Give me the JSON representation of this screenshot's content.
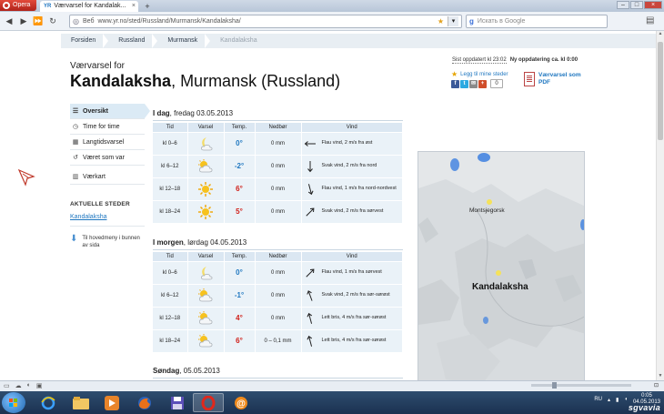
{
  "browser": {
    "opera_label": "Opera",
    "tab_icon": "YR",
    "tab_title": "Værvarsel for Kandalak...",
    "tab_close": "×",
    "new_tab": "+",
    "address_label": "Веб",
    "url": "www.yr.no/sted/Russland/Murmansk/Kandalaksha/",
    "search_placeholder": "Искать в Google"
  },
  "breadcrumbs": [
    "Forsiden",
    "Russland",
    "Murmansk",
    "Kandalaksha"
  ],
  "header": {
    "sub": "Værvarsel for",
    "place": "Kandalaksha",
    "region": ", Murmansk (Russland)",
    "updated_label": "Sist oppdatert kl 23:02",
    "next_update": "Ny oppdatering ca. kl 0:00",
    "add_favorite": "Legg til mine steder",
    "social_count": "0",
    "pdf_label": "Værvarsel som PDF"
  },
  "sidebar": {
    "items": [
      {
        "label": "Oversikt",
        "icon": "list-icon"
      },
      {
        "label": "Time for time",
        "icon": "clock-icon"
      },
      {
        "label": "Langtidsvarsel",
        "icon": "calendar-icon"
      },
      {
        "label": "Været som var",
        "icon": "history-icon"
      },
      {
        "label": "Værkart",
        "icon": "map-icon"
      }
    ],
    "current_heading": "AKTUELLE STEDER",
    "current_place": "Kandalaksha",
    "to_top": "Til hovedmeny i bunnen av sida"
  },
  "columns": [
    "Tid",
    "Varsel",
    "Temp.",
    "Nedbør",
    "Vind"
  ],
  "days": [
    {
      "prefix": "I dag",
      "date": ", fredag 03.05.2013",
      "rows": [
        {
          "time": "kl 0–6",
          "symbol": "moon-partly",
          "temp": "0°",
          "temp_color": "#1f77c0",
          "precip": "0 mm",
          "wind": "Flau vind, 2 m/s fra øst",
          "wind_dir": 270
        },
        {
          "time": "kl 6–12",
          "symbol": "partly-cloudy",
          "temp": "-2°",
          "temp_color": "#1f77c0",
          "precip": "0 mm",
          "wind": "Svak vind, 2 m/s fra nord",
          "wind_dir": 180
        },
        {
          "time": "kl 12–18",
          "symbol": "sun",
          "temp": "6°",
          "temp_color": "#d0201a",
          "precip": "0 mm",
          "wind": "Flau vind, 1 m/s fra nord-nordvest",
          "wind_dir": 165
        },
        {
          "time": "kl 18–24",
          "symbol": "sun",
          "temp": "5°",
          "temp_color": "#d0201a",
          "precip": "0 mm",
          "wind": "Svak vind, 2 m/s fra sørvest",
          "wind_dir": 45
        }
      ]
    },
    {
      "prefix": "I morgen",
      "date": ", lørdag 04.05.2013",
      "rows": [
        {
          "time": "kl 0–6",
          "symbol": "moon-partly",
          "temp": "0°",
          "temp_color": "#1f77c0",
          "precip": "0 mm",
          "wind": "Flau vind, 1 m/s fra sørvest",
          "wind_dir": 45
        },
        {
          "time": "kl 6–12",
          "symbol": "partly-cloudy",
          "temp": "-1°",
          "temp_color": "#1f77c0",
          "precip": "0 mm",
          "wind": "Svak vind, 2 m/s fra sør-sørøst",
          "wind_dir": 340
        },
        {
          "time": "kl 12–18",
          "symbol": "partly-cloudy",
          "temp": "4°",
          "temp_color": "#d0201a",
          "precip": "0 mm",
          "wind": "Lett bris, 4 m/s fra sør-sørøst",
          "wind_dir": 345
        },
        {
          "time": "kl 18–24",
          "symbol": "partly-cloudy",
          "temp": "6°",
          "temp_color": "#d0201a",
          "precip": "0 – 0,1 mm",
          "wind": "Lett bris, 4 m/s fra sør-sørøst",
          "wind_dir": 345
        }
      ]
    },
    {
      "prefix": "Søndag",
      "date": ", 05.05.2013",
      "rows": []
    }
  ],
  "map": {
    "places": [
      "Montsjegorsk"
    ],
    "city": "Kandalaksha"
  },
  "taskbar": {
    "lang": "RU",
    "time": "0:05",
    "date": "04.05.2013",
    "watermark": "sgvavia"
  }
}
